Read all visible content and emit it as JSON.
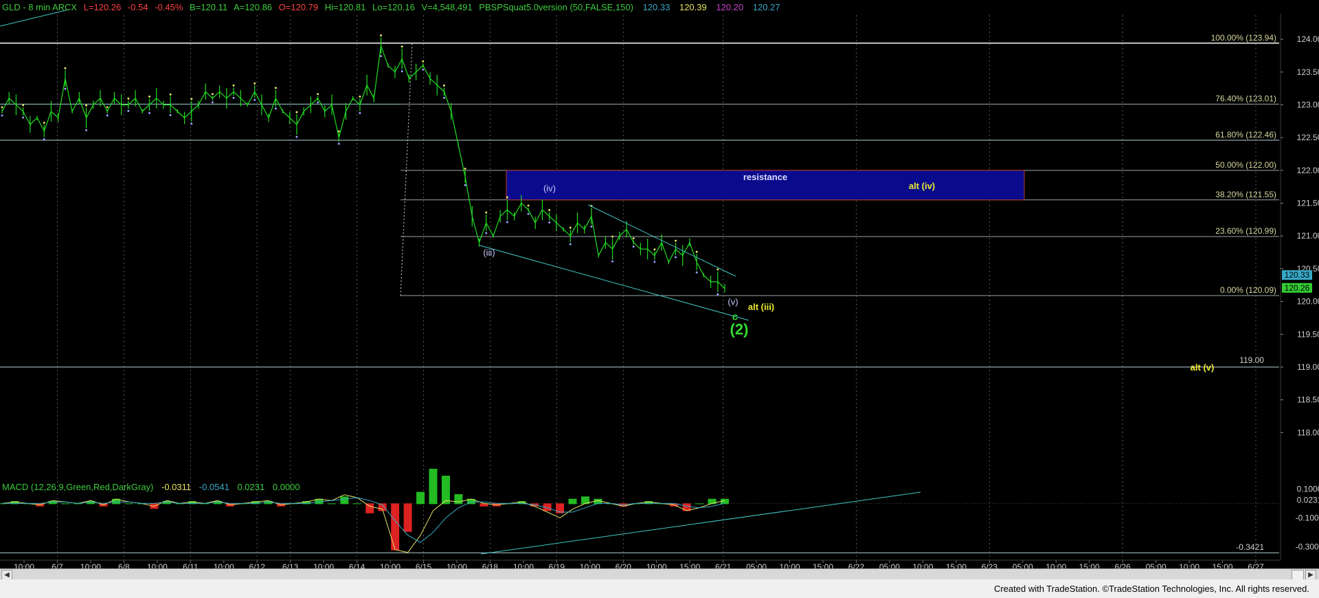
{
  "header": {
    "symbol": "GLD - 8 min  ARCX",
    "last": "L=120.26",
    "change": "-0.54",
    "change_pct": "-0.45%",
    "bid": "B=120.11",
    "ask": "A=120.86",
    "open": "O=120.79",
    "high": "Hi=120.81",
    "low": "Lo=120.16",
    "volume": "V=4,548,491",
    "study": "PBSPSquat5.0version (50,FALSE,150)",
    "study_values": [
      {
        "text": "120.33",
        "color": "#37a8c7"
      },
      {
        "text": "120.39",
        "color": "#e3e366"
      },
      {
        "text": "120.20",
        "color": "#cc44cc"
      },
      {
        "text": "120.27",
        "color": "#37a8c7"
      }
    ]
  },
  "macd_header": {
    "label": "MACD (12,26,9,Green,Red,DarkGray)",
    "values": [
      {
        "text": "-0.0311",
        "color": "#e3e366"
      },
      {
        "text": "-0.0541",
        "color": "#37a8c7"
      },
      {
        "text": "0.0231",
        "color": "#3ccc3c"
      },
      {
        "text": "0.0000",
        "color": "#3ccc3c"
      }
    ]
  },
  "footer": {
    "text": "Created with TradeStation. ©TradeStation Technologies, Inc. All rights reserved."
  },
  "colors": {
    "background": "#000000",
    "price": "#22dd22",
    "grid": "#5a5a5a",
    "fib_line": "#9aa7aa",
    "trendline": "#3fc7c7",
    "resistance_fill": "#0a0a8c",
    "label_yellow": "#eeee33",
    "label_green": "#33dd33",
    "label_white": "#c8c8ff",
    "fib_text": "#d6d6a0"
  },
  "chart_data": [
    {
      "type": "line",
      "title": "",
      "price_axis": {
        "ticks": [
          "124.00",
          "123.50",
          "123.00",
          "122.50",
          "122.00",
          "121.50",
          "121.00",
          "120.50",
          "120.00",
          "119.50",
          "119.00",
          "118.50",
          "118.00"
        ],
        "ylim": [
          117.7,
          124.2
        ],
        "last_price_tags": [
          "120.33",
          "120.26"
        ]
      },
      "time_axis": {
        "ticks": [
          "10:00",
          "6/7",
          "10:00",
          "6/8",
          "10:00",
          "6/11",
          "10:00",
          "6/12",
          "6/13",
          "10:00",
          "6/14",
          "10:00",
          "6/15",
          "10:00",
          "6/18",
          "10:00",
          "6/19",
          "10:00",
          "6/20",
          "10:00",
          "15:00",
          "6/21",
          "05:00",
          "10:00",
          "15:00",
          "6/22",
          "05:00",
          "10:00",
          "15:00",
          "6/23",
          "05:00",
          "10:00",
          "15:00",
          "6/26",
          "05:00",
          "10:00",
          "15:00",
          "6/27"
        ]
      },
      "fib_levels": [
        {
          "label": "100.00% (123.94)",
          "value": 123.94
        },
        {
          "label": "76.40% (123.01)",
          "value": 123.01
        },
        {
          "label": "61.80% (122.46)",
          "value": 122.46
        },
        {
          "label": "50.00% (122.00)",
          "value": 122.0
        },
        {
          "label": "38.20% (121.55)",
          "value": 121.55
        },
        {
          "label": "23.60% (120.99)",
          "value": 120.99
        },
        {
          "label": "0.00% (120.09)",
          "value": 120.09
        }
      ],
      "horizontal_lines": [
        {
          "label": "119.00",
          "value": 119.0
        },
        {
          "label": "",
          "value": 122.46
        }
      ],
      "resistance_zone": {
        "label": "resistance",
        "low": 121.55,
        "high": 122.0,
        "inner_label": "alt (iv)"
      },
      "wave_labels": [
        {
          "text": "(iv)",
          "value": 121.68
        },
        {
          "text": "(iii)",
          "value": 120.7
        },
        {
          "text": "(v)",
          "value": 119.95
        },
        {
          "text": "alt (iii)",
          "value": 119.87
        },
        {
          "text": "c",
          "value": 119.72
        },
        {
          "text": "(2)",
          "value": 119.5
        },
        {
          "text": "alt (v)",
          "value": 118.95
        }
      ],
      "series": [
        {
          "name": "GLD",
          "values": [
            122.9,
            123.1,
            123.0,
            122.9,
            122.7,
            122.8,
            122.6,
            122.9,
            122.8,
            123.4,
            122.9,
            123.1,
            122.8,
            123.0,
            123.1,
            122.9,
            123.1,
            123.0,
            123.0,
            123.1,
            122.9,
            123.0,
            123.1,
            123.0,
            123.0,
            122.9,
            122.8,
            122.9,
            123.0,
            123.2,
            123.1,
            123.2,
            123.1,
            123.2,
            123.1,
            123.0,
            123.2,
            123.0,
            122.8,
            123.1,
            122.9,
            122.8,
            122.7,
            122.9,
            123.0,
            123.1,
            122.9,
            123.0,
            122.5,
            122.9,
            123.1,
            123.0,
            123.3,
            123.1,
            123.9,
            123.6,
            123.5,
            123.7,
            123.4,
            123.5,
            123.6,
            123.4,
            123.3,
            123.2,
            122.9,
            122.4,
            121.9,
            121.3,
            120.9,
            121.2,
            121.0,
            121.3,
            121.4,
            121.3,
            121.5,
            121.4,
            121.2,
            121.4,
            121.3,
            121.2,
            121.1,
            121.0,
            121.2,
            121.1,
            121.3,
            120.7,
            120.9,
            120.8,
            121.0,
            121.1,
            120.9,
            120.8,
            120.8,
            120.7,
            120.9,
            120.6,
            120.8,
            120.7,
            120.9,
            120.6,
            120.4,
            120.3,
            120.3,
            120.2
          ]
        }
      ]
    },
    {
      "type": "line",
      "title": "MACD (12,26,9,Green,Red,DarkGray)",
      "yaxis": {
        "ticks": [
          "0.1000",
          "0.0231",
          "-0.1000",
          "-0.3000"
        ],
        "extra_label": "-0.3421",
        "ylim": [
          -0.36,
          0.14
        ]
      },
      "series": [
        {
          "name": "MACD",
          "values": [
            0.0,
            0.01,
            0.0,
            -0.01,
            0.02,
            0.01,
            0.0,
            0.02,
            -0.01,
            0.03,
            0.01,
            0.0,
            -0.02,
            0.02,
            0.0,
            0.01,
            0.0,
            0.02,
            -0.01,
            0.0,
            0.01,
            0.02,
            -0.01,
            0.0,
            0.01,
            0.03,
            0.02,
            0.06,
            0.04,
            -0.02,
            -0.04,
            -0.32,
            -0.34,
            -0.22,
            -0.05,
            0.02,
            0.01,
            0.03,
            0.0,
            -0.01,
            0.0,
            0.01,
            -0.02,
            -0.06,
            -0.1,
            -0.04,
            0.0,
            0.02,
            0.0,
            -0.02,
            0.0,
            0.01,
            0.0,
            -0.01,
            -0.05,
            -0.03,
            0.0,
            0.02
          ]
        },
        {
          "name": "Signal",
          "values": [
            0.0,
            0.0,
            0.0,
            0.0,
            0.01,
            0.01,
            0.0,
            0.01,
            0.0,
            0.01,
            0.01,
            0.0,
            0.0,
            0.01,
            0.0,
            0.0,
            0.0,
            0.01,
            0.0,
            0.0,
            0.0,
            0.01,
            0.0,
            0.0,
            0.0,
            0.01,
            0.02,
            0.03,
            0.04,
            0.02,
            -0.01,
            -0.12,
            -0.22,
            -0.27,
            -0.2,
            -0.1,
            -0.03,
            0.01,
            0.01,
            0.0,
            0.0,
            0.0,
            -0.01,
            -0.03,
            -0.06,
            -0.06,
            -0.03,
            0.0,
            0.0,
            -0.01,
            0.0,
            0.0,
            0.0,
            0.0,
            -0.02,
            -0.03,
            -0.02,
            0.0
          ]
        }
      ]
    }
  ]
}
